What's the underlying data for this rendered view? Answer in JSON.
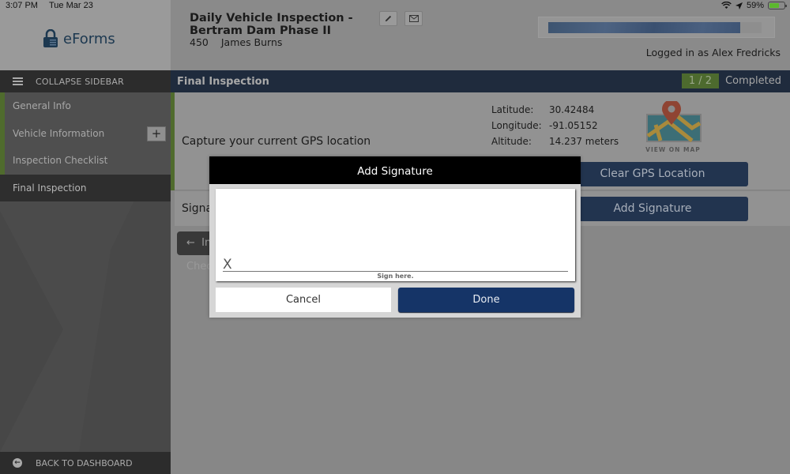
{
  "status_bar": {
    "time": "3:07 PM",
    "date": "Tue Mar 23",
    "battery_percent": "59%",
    "battery_level": 0.59
  },
  "sidebar": {
    "logo_text": "eForms",
    "collapse_label": "COLLAPSE SIDEBAR",
    "items": [
      {
        "label": "General Info",
        "active": false
      },
      {
        "label": "Vehicle Information",
        "active": false,
        "expand_label": "+"
      },
      {
        "label": "Inspection Checklist",
        "active": false
      },
      {
        "label": "Final Inspection",
        "active": true
      }
    ],
    "back_label": "BACK TO DASHBOARD"
  },
  "header": {
    "title_line1": "Daily Vehicle Inspection -",
    "title_line2": "Bertram Dam Phase II",
    "form_number": "450",
    "assignee": "James  Burns",
    "progress_fraction": 0.9,
    "logged_in": "Logged in as Alex Fredricks"
  },
  "section": {
    "title": "Final Inspection",
    "count": "1 / 2",
    "status": "Completed",
    "accent_color": "#4d6a2e"
  },
  "gps": {
    "label": "Capture your current GPS location",
    "latitude_label": "Latitude:",
    "latitude": "30.42484",
    "longitude_label": "Longitude:",
    "longitude": "-91.05152",
    "altitude_label": "Altitude:",
    "altitude": "14.237 meters",
    "map_caption": "VIEW ON MAP",
    "clear_button": "Clear GPS Location"
  },
  "signature": {
    "label": "Signature",
    "add_button": "Add Signature"
  },
  "nav": {
    "prev_label": "Inspection Checklist"
  },
  "modal": {
    "title": "Add Signature",
    "x_mark": "X",
    "hint": "Sign here.",
    "cancel": "Cancel",
    "done": "Done",
    "done_color": "#153467"
  }
}
